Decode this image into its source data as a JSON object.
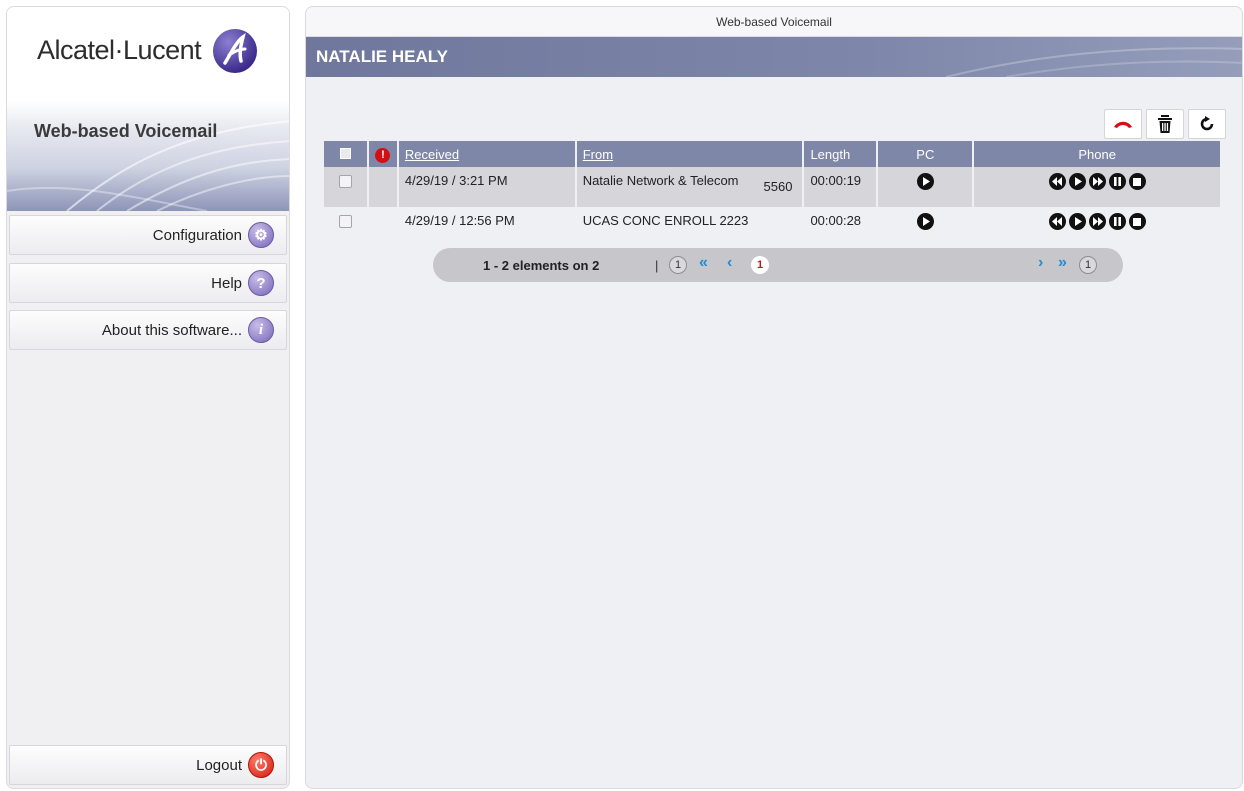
{
  "brand": {
    "name": "Alcatel·Lucent",
    "logo_icon": "alcatel-lucent-a-logo-icon"
  },
  "sidebar": {
    "banner_title": "Web-based Voicemail",
    "items": [
      {
        "label": "Configuration",
        "icon": "gear-icon"
      },
      {
        "label": "Help",
        "icon": "question-icon"
      },
      {
        "label": "About this software...",
        "icon": "info-icon"
      }
    ],
    "logout": {
      "label": "Logout",
      "icon": "power-icon"
    }
  },
  "main": {
    "title": "Web-based Voicemail",
    "user_name": "NATALIE HEALY",
    "toolbar": [
      {
        "icon": "hang-up-icon"
      },
      {
        "icon": "trash-icon"
      },
      {
        "icon": "refresh-icon"
      }
    ]
  },
  "table": {
    "headers": {
      "received": "Received",
      "from": "From",
      "length": "Length",
      "pc": "PC",
      "phone": "Phone"
    },
    "rows": [
      {
        "received": "4/29/19 / 3:21 PM",
        "from_name": "Natalie Network & Telecom",
        "from_number": "5560",
        "length": "00:00:19",
        "selected": true
      },
      {
        "received": "4/29/19 / 12:56 PM",
        "from_name": "UCAS CONC ENROLL 2223",
        "from_number": "",
        "length": "00:00:28",
        "selected": false
      }
    ]
  },
  "pager": {
    "info": "1 - 2 elements on 2",
    "separator": "|",
    "first_page": "1",
    "current_page": "1",
    "last_page": "1"
  },
  "colors": {
    "header": "#7e87a8",
    "accent_link": "#1f8fd3",
    "alert": "#d40f14"
  }
}
